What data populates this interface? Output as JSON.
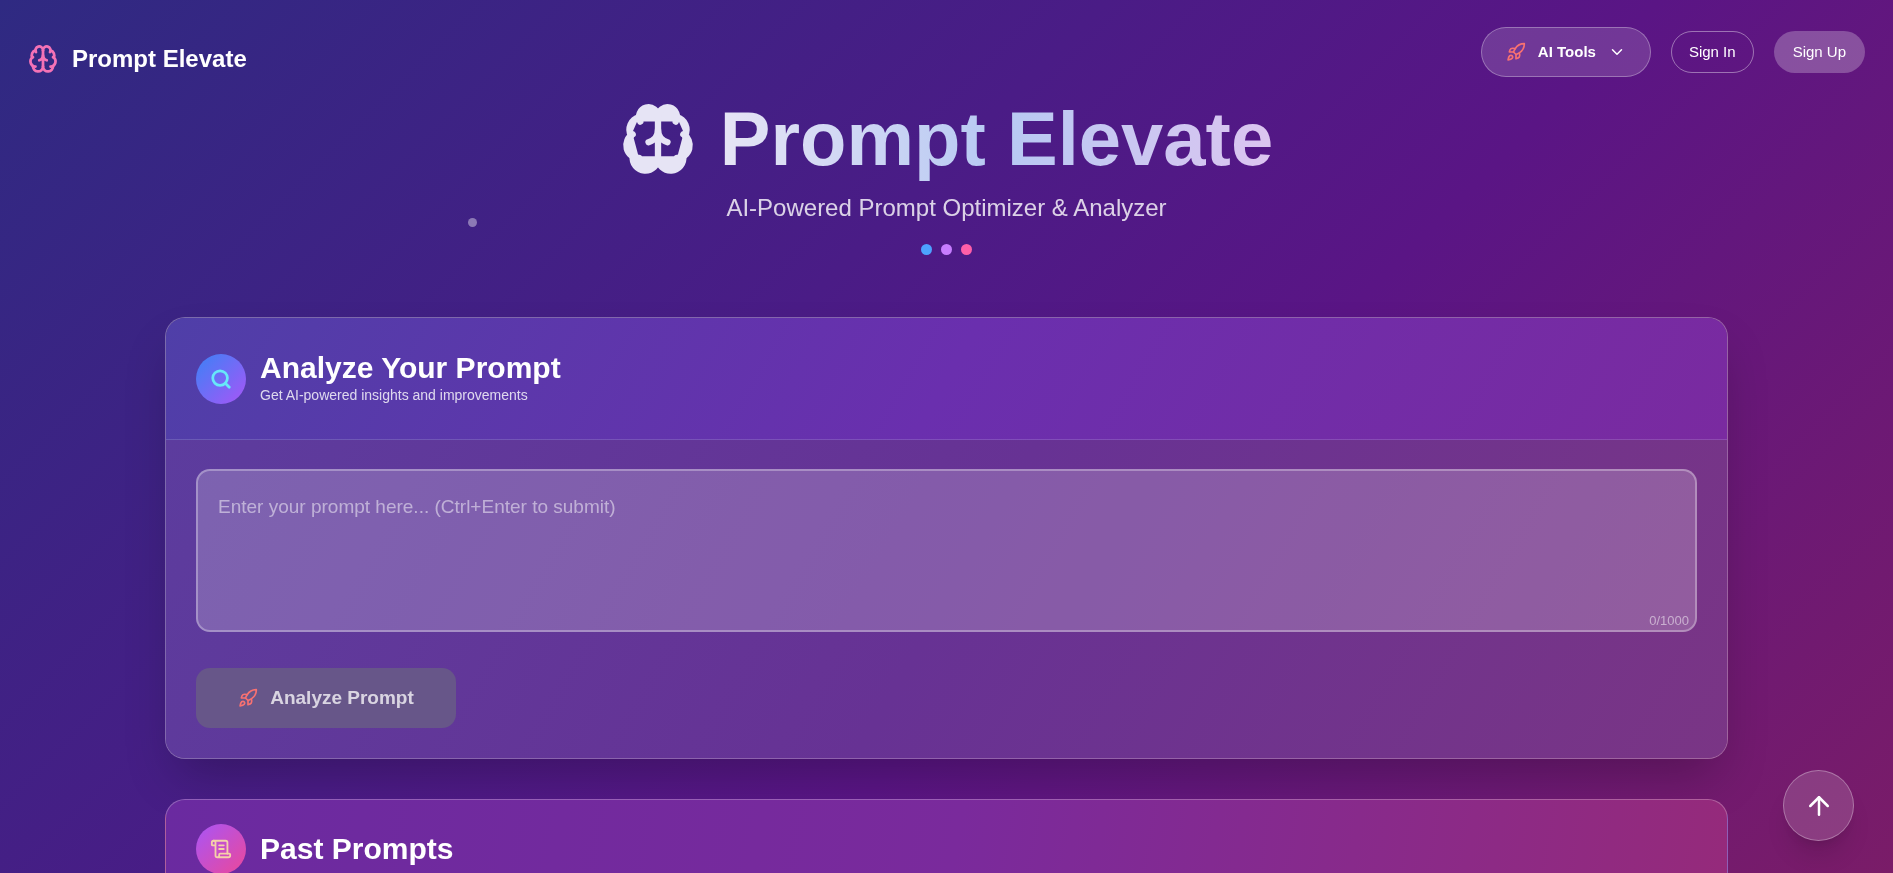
{
  "nav": {
    "brand": "Prompt Elevate",
    "tools_menu": {
      "label": "AI Tools",
      "expanded": false
    },
    "buttons": [
      {
        "label": "Sign In",
        "kind": "outline"
      },
      {
        "label": "Sign Up",
        "kind": "filled"
      }
    ]
  },
  "hero": {
    "title": "Prompt Elevate",
    "subtitle": "AI-Powered Prompt Optimizer & Analyzer",
    "dots": [
      {
        "color": "#4da3ff"
      },
      {
        "color": "#c77dff"
      },
      {
        "color": "#ff5fa8"
      }
    ]
  },
  "analyze_card": {
    "title": "Analyze Your Prompt",
    "subtitle": "Get AI-powered insights and improvements",
    "prompt": {
      "placeholder": "Enter your prompt here... (Ctrl+Enter to submit)",
      "counter": "0/1000"
    },
    "submit": {
      "label": "Analyze Prompt",
      "disabled": true
    }
  },
  "past_card": {
    "title": "Past Prompts"
  }
}
